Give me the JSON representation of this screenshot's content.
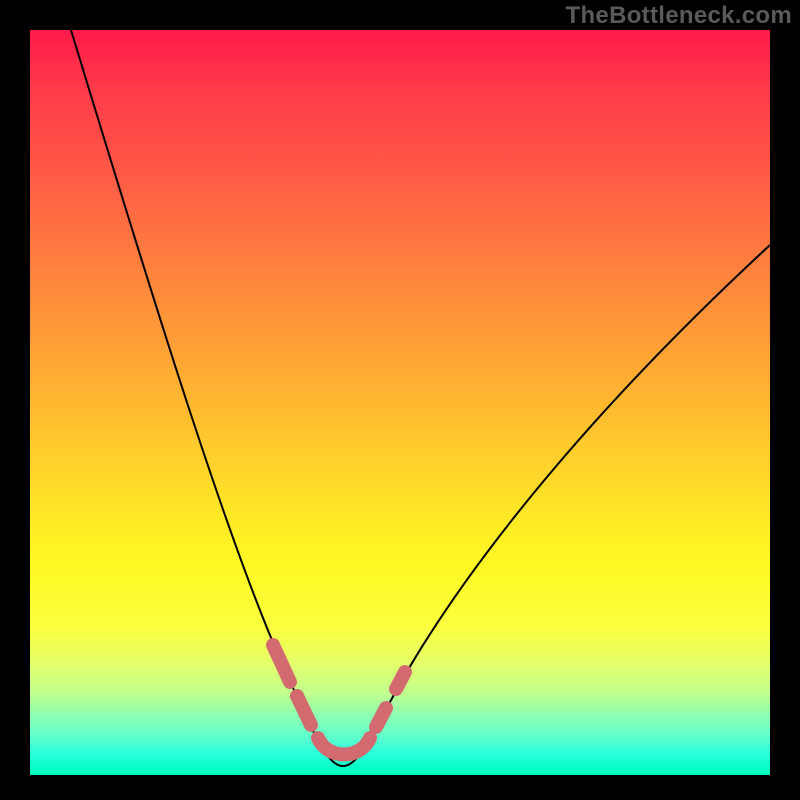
{
  "watermark": "TheBottleneck.com",
  "colors": {
    "frame": "#000000",
    "curve": "#000000",
    "marker": "#d36a6f",
    "gradient_top": "#ff1a49",
    "gradient_bottom": "#00ffba"
  },
  "chart_data": {
    "type": "line",
    "title": "",
    "xlabel": "",
    "ylabel": "",
    "xlim": [
      0,
      100
    ],
    "ylim": [
      0,
      100
    ],
    "series": [
      {
        "name": "bottleneck-curve",
        "x": [
          5,
          10,
          15,
          20,
          25,
          28,
          30,
          32,
          34,
          36,
          38,
          40,
          42,
          44,
          46,
          50,
          55,
          60,
          65,
          70,
          75,
          80,
          85,
          90,
          95,
          100
        ],
        "values": [
          100,
          84,
          68,
          53,
          38,
          29,
          22,
          15,
          10,
          6,
          3,
          1,
          1,
          2,
          5,
          12,
          21,
          29,
          36,
          43,
          49,
          54,
          59,
          63,
          67,
          71
        ]
      }
    ],
    "highlighted_region": {
      "name": "optimal-range-markers",
      "x": [
        31,
        33,
        36,
        39,
        40,
        42,
        44,
        46,
        48,
        49
      ],
      "values": [
        18,
        11,
        6,
        2,
        1,
        1,
        3,
        6,
        10,
        14
      ]
    },
    "annotations": [
      {
        "text": "TheBottleneck.com",
        "position": "top-right"
      }
    ]
  }
}
